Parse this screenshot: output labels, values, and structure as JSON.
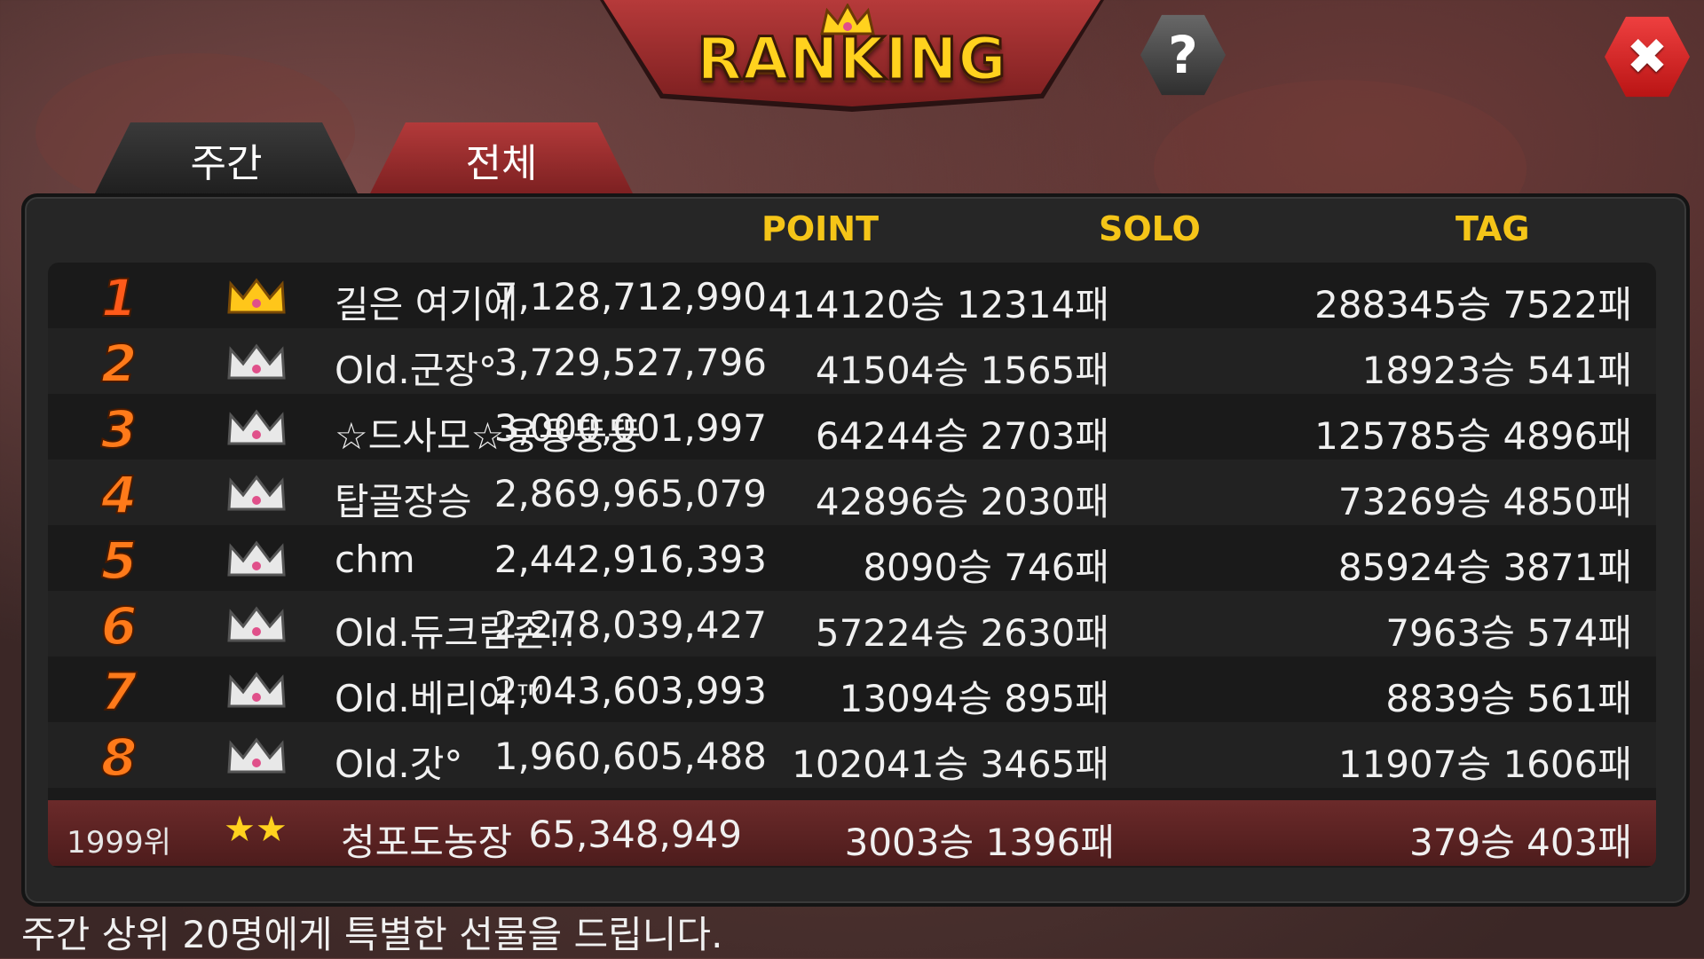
{
  "header": {
    "title": "RANKING"
  },
  "buttons": {
    "help": "?",
    "close": "✖"
  },
  "tabs": [
    {
      "label": "주간",
      "active": true
    },
    {
      "label": "전체",
      "active": false
    }
  ],
  "columns": {
    "point": "POINT",
    "solo": "SOLO",
    "tag": "TAG"
  },
  "rows": [
    {
      "rank": "1",
      "crown": "gold",
      "name": "길은 여기에",
      "point": "7,128,712,990",
      "solo": "414120승 12314패",
      "tag": "288345승 7522패"
    },
    {
      "rank": "2",
      "crown": "silver",
      "name": "Old.군장°",
      "point": "3,729,527,796",
      "solo": "41504승 1565패",
      "tag": "18923승 541패"
    },
    {
      "rank": "3",
      "crown": "silver",
      "name": "☆드사모☆용용뚱뚱",
      "point": "3,000,001,997",
      "solo": "64244승 2703패",
      "tag": "125785승 4896패"
    },
    {
      "rank": "4",
      "crown": "silver",
      "name": "탑골장승",
      "point": "2,869,965,079",
      "solo": "42896승 2030패",
      "tag": "73269승 4850패"
    },
    {
      "rank": "5",
      "crown": "silver",
      "name": "chm",
      "point": "2,442,916,393",
      "solo": "8090승 746패",
      "tag": "85924승 3871패"
    },
    {
      "rank": "6",
      "crown": "silver",
      "name": "Old.듀크림존!!",
      "point": "2,278,039,427",
      "solo": "57224승 2630패",
      "tag": "7963승 574패"
    },
    {
      "rank": "7",
      "crown": "silver",
      "name": "Old.베리어™",
      "point": "2,043,603,993",
      "solo": "13094승 895패",
      "tag": "8839승 561패"
    },
    {
      "rank": "8",
      "crown": "silver",
      "name": "Old.갓°",
      "point": "1,960,605,488",
      "solo": "102041승 3465패",
      "tag": "11907승 1606패"
    }
  ],
  "my_row": {
    "rank": "1999위",
    "badge": "★★",
    "name": "청포도농장",
    "point": "65,348,949",
    "solo": "3003승 1396패",
    "tag": "379승 403패"
  },
  "footer": "주간 상위 20명에게 특별한 선물을 드립니다.",
  "colors": {
    "accent_gold": "#f5c518",
    "rank_orange": "#ff7a1a",
    "close_red": "#e02a2a",
    "tab_active": "#2a2a2a",
    "tab_inactive": "#9a2a2b"
  }
}
